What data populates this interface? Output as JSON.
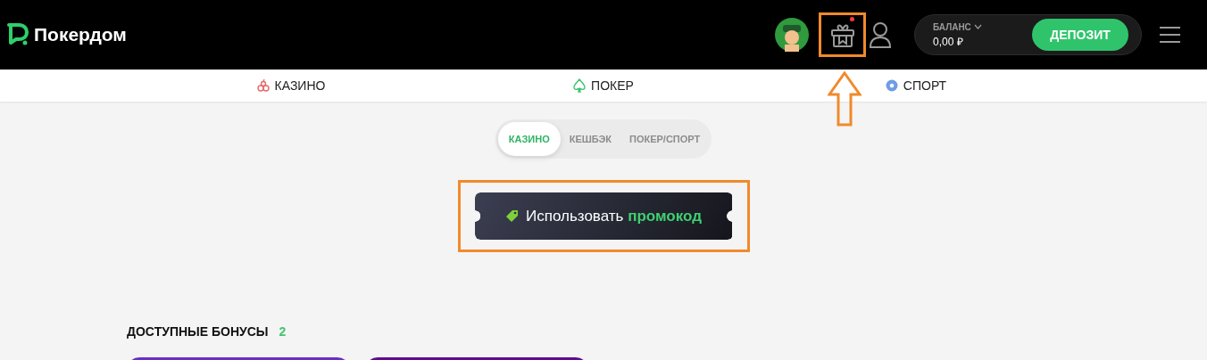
{
  "header": {
    "logo": "Покердом",
    "gift_notification": true,
    "balance_label": "БАЛАНС",
    "balance": "0,00 ₽",
    "deposit": "ДЕПОЗИТ"
  },
  "nav": [
    {
      "kind": "cherry",
      "label": "КАЗИНО"
    },
    {
      "kind": "spade",
      "label": "ПОКЕР"
    },
    {
      "kind": "ball",
      "label": "СПОРТ"
    }
  ],
  "tabs": [
    {
      "label": "КАЗИНО",
      "selected": true
    },
    {
      "label": "КЕШБЭК",
      "selected": false
    },
    {
      "label": "ПОКЕР/СПОРТ",
      "selected": false
    }
  ],
  "promo": {
    "label": "Использовать",
    "highlight": "промокод"
  },
  "bonuses": {
    "title": "ДОСТУПНЫЕ БОНУСЫ",
    "count": "2",
    "cards": [
      {
        "color": "#6a2ec0"
      },
      {
        "color": "#5e0b8e"
      }
    ]
  }
}
